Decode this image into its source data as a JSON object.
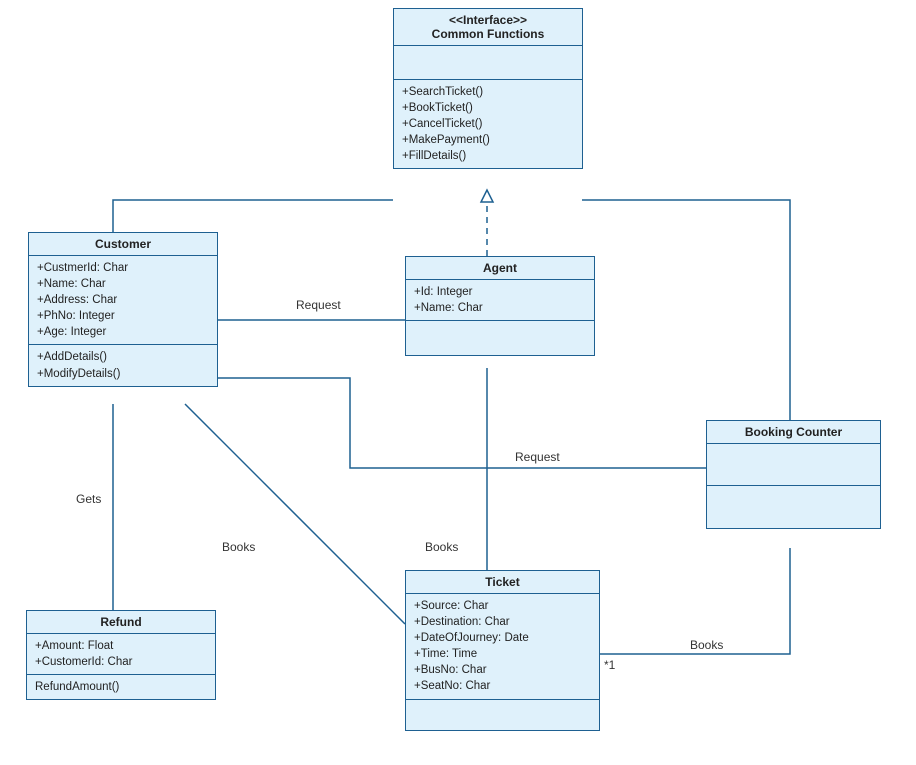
{
  "chart_data": {
    "type": "uml-class-diagram",
    "classes": [
      {
        "id": "common",
        "stereotype": "<<Interface>>",
        "name": "Common Functions",
        "attributes": [],
        "operations": [
          "+SearchTicket()",
          "+BookTicket()",
          "+CancelTicket()",
          "+MakePayment()",
          "+FillDetails()"
        ]
      },
      {
        "id": "customer",
        "name": "Customer",
        "attributes": [
          "+CustmerId: Char",
          "+Name: Char",
          "+Address: Char",
          "+PhNo: Integer",
          "+Age: Integer"
        ],
        "operations": [
          "+AddDetails()",
          "+ModifyDetails()"
        ]
      },
      {
        "id": "agent",
        "name": "Agent",
        "attributes": [
          "+Id: Integer",
          "+Name: Char"
        ],
        "operations": []
      },
      {
        "id": "booking",
        "name": "Booking Counter",
        "attributes": [],
        "operations": []
      },
      {
        "id": "refund",
        "name": "Refund",
        "attributes": [
          "+Amount: Float",
          "+CustomerId: Char"
        ],
        "operations": [
          "RefundAmount()"
        ]
      },
      {
        "id": "ticket",
        "name": "Ticket",
        "attributes": [
          "+Source: Char",
          "+Destination: Char",
          "+DateOfJourney: Date",
          "+Time: Time",
          "+BusNo: Char",
          "+SeatNo: Char"
        ],
        "operations": []
      }
    ],
    "relationships": [
      {
        "from": "customer",
        "to": "common",
        "type": "association"
      },
      {
        "from": "booking",
        "to": "common",
        "type": "association"
      },
      {
        "from": "agent",
        "to": "common",
        "type": "realization"
      },
      {
        "from": "customer",
        "to": "agent",
        "type": "association",
        "label": "Request"
      },
      {
        "from": "customer",
        "to": "booking",
        "type": "association",
        "label": "Request"
      },
      {
        "from": "customer",
        "to": "refund",
        "type": "association",
        "label": "Gets"
      },
      {
        "from": "customer",
        "to": "ticket",
        "type": "association",
        "label": "Books"
      },
      {
        "from": "agent",
        "to": "ticket",
        "type": "association",
        "label": "Books"
      },
      {
        "from": "booking",
        "to": "ticket",
        "type": "association",
        "label": "Books",
        "multiplicity": "*1"
      }
    ]
  },
  "classes": {
    "common": {
      "stereotype": "<<Interface>>",
      "name": "Common Functions",
      "ops": "+SearchTicket()\n+BookTicket()\n+CancelTicket()\n+MakePayment()\n+FillDetails()"
    },
    "customer": {
      "name": "Customer",
      "attrs": "+CustmerId: Char\n+Name: Char\n+Address: Char\n+PhNo: Integer\n+Age: Integer",
      "ops": "+AddDetails()\n+ModifyDetails()"
    },
    "agent": {
      "name": "Agent",
      "attrs": "+Id: Integer\n+Name: Char"
    },
    "booking": {
      "name": "Booking Counter"
    },
    "refund": {
      "name": "Refund",
      "attrs": "+Amount: Float\n+CustomerId: Char",
      "ops": "RefundAmount()"
    },
    "ticket": {
      "name": "Ticket",
      "attrs": "+Source: Char\n+Destination: Char\n+DateOfJourney: Date\n+Time: Time\n+BusNo: Char\n+SeatNo: Char"
    }
  },
  "labels": {
    "request1": "Request",
    "request2": "Request",
    "gets": "Gets",
    "books1": "Books",
    "books2": "Books",
    "books3": "Books",
    "mult": "*1"
  }
}
